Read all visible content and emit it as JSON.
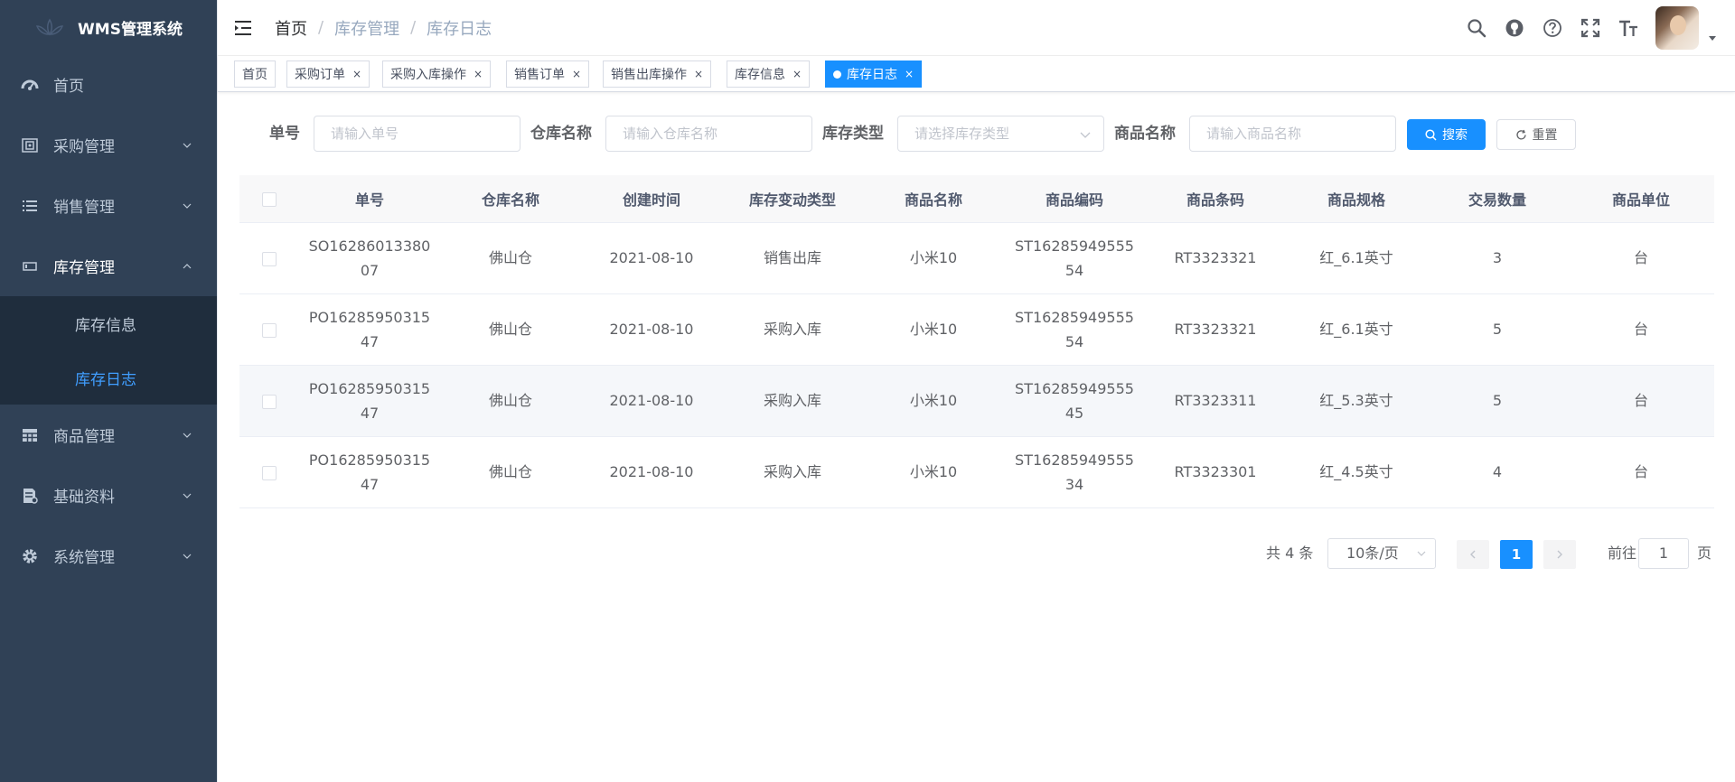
{
  "sidebar": {
    "title": "WMS管理系统",
    "items": [
      {
        "label": "首页",
        "icon": "dashboard-icon"
      },
      {
        "label": "采购管理",
        "icon": "purchase-icon"
      },
      {
        "label": "销售管理",
        "icon": "list-icon"
      },
      {
        "label": "库存管理",
        "icon": "inventory-icon"
      },
      {
        "label": "商品管理",
        "icon": "table-icon"
      },
      {
        "label": "基础资料",
        "icon": "document-icon"
      },
      {
        "label": "系统管理",
        "icon": "gear-icon"
      }
    ],
    "submenu": [
      {
        "label": "库存信息"
      },
      {
        "label": "库存日志"
      }
    ]
  },
  "breadcrumb": [
    "首页",
    "库存管理",
    "库存日志"
  ],
  "tags": [
    {
      "label": "首页"
    },
    {
      "label": "采购订单"
    },
    {
      "label": "采购入库操作"
    },
    {
      "label": "销售订单"
    },
    {
      "label": "销售出库操作"
    },
    {
      "label": "库存信息"
    },
    {
      "label": "库存日志"
    }
  ],
  "search": {
    "order_label": "单号",
    "order_placeholder": "请输入单号",
    "warehouse_label": "仓库名称",
    "warehouse_placeholder": "请输入仓库名称",
    "type_label": "库存类型",
    "type_placeholder": "请选择库存类型",
    "product_label": "商品名称",
    "product_placeholder": "请输入商品名称",
    "search_btn": "搜索",
    "reset_btn": "重置"
  },
  "table": {
    "columns": [
      "单号",
      "仓库名称",
      "创建时间",
      "库存变动类型",
      "商品名称",
      "商品编码",
      "商品条码",
      "商品规格",
      "交易数量",
      "商品单位"
    ],
    "rows": [
      [
        "SO1628601338007",
        "佛山仓",
        "2021-08-10",
        "销售出库",
        "小米10",
        "ST1628594955554",
        "RT3323321",
        "红_6.1英寸",
        "3",
        "台"
      ],
      [
        "PO1628595031547",
        "佛山仓",
        "2021-08-10",
        "采购入库",
        "小米10",
        "ST1628594955554",
        "RT3323321",
        "红_6.1英寸",
        "5",
        "台"
      ],
      [
        "PO1628595031547",
        "佛山仓",
        "2021-08-10",
        "采购入库",
        "小米10",
        "ST1628594955545",
        "RT3323311",
        "红_5.3英寸",
        "5",
        "台"
      ],
      [
        "PO1628595031547",
        "佛山仓",
        "2021-08-10",
        "采购入库",
        "小米10",
        "ST1628594955534",
        "RT3323301",
        "红_4.5英寸",
        "4",
        "台"
      ]
    ]
  },
  "pagination": {
    "total": "共 4 条",
    "page_size": "10条/页",
    "current": "1",
    "goto_label": "前往",
    "goto_value": "1",
    "page_suffix": "页"
  },
  "colors": {
    "sidebar": "#304156",
    "submenu": "#1f2d3d",
    "accent": "#1890ff"
  }
}
